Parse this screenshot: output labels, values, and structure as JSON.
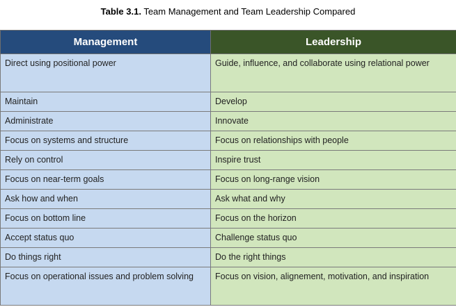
{
  "caption": {
    "label": "Table 3.1.",
    "text": " Team Management and Team Leadership Compared"
  },
  "table": {
    "headers": [
      "Management",
      "Leadership"
    ],
    "rows": [
      [
        "Direct using positional power",
        "Guide, influence, and collaborate using relational power"
      ],
      [
        "Maintain",
        "Develop"
      ],
      [
        "Administrate",
        "Innovate"
      ],
      [
        "Focus on systems and structure",
        "Focus on relationships with people"
      ],
      [
        "Rely on control",
        "Inspire trust"
      ],
      [
        "Focus on near-term goals",
        "Focus on long-range vision"
      ],
      [
        "Ask how and when",
        "Ask what and why"
      ],
      [
        "Focus on bottom line",
        "Focus on the horizon"
      ],
      [
        "Accept status quo",
        "Challenge status quo"
      ],
      [
        "Do things right",
        "Do the right things"
      ],
      [
        "Focus on operational issues and problem solving",
        "Focus on vision, alignement, motivation, and inspiration"
      ]
    ]
  },
  "colors": {
    "management_header": "#254b7c",
    "leadership_header": "#3a5528",
    "management_cell": "#c6d9f0",
    "leadership_cell": "#d1e6bd"
  }
}
